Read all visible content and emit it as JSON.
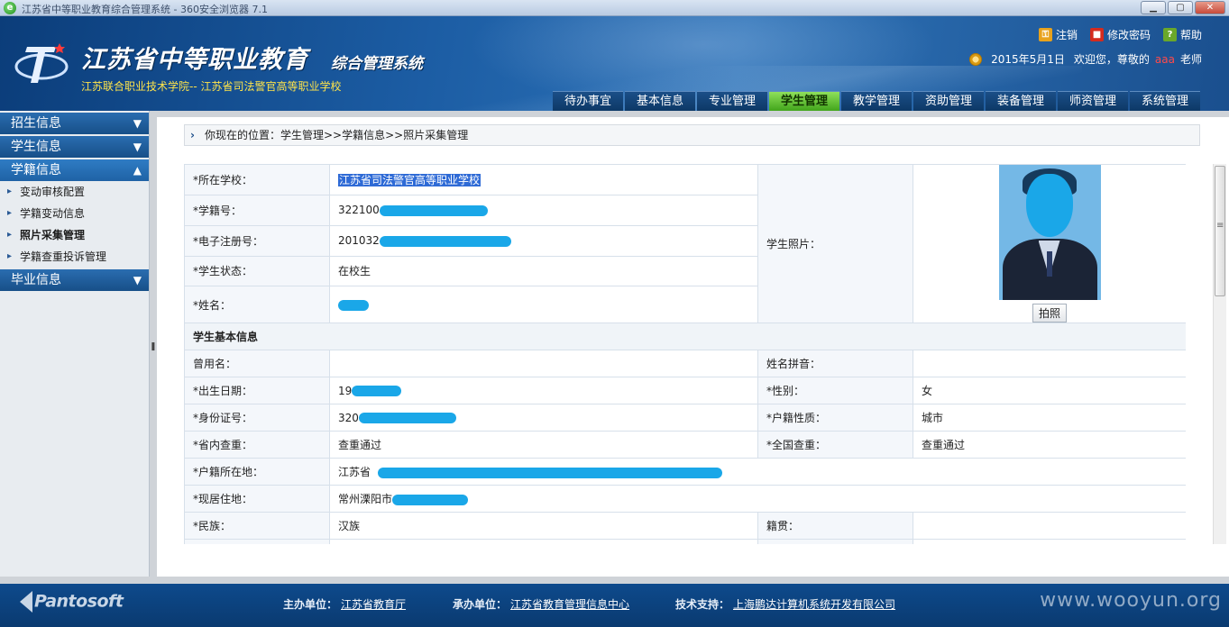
{
  "browser": {
    "title": "江苏省中等职业教育综合管理系统 - 360安全浏览器 7.1",
    "minimize": "▁",
    "maximize": "▢",
    "close": "✕"
  },
  "header": {
    "title": "江苏省中等职业教育",
    "subtitle": "综合管理系统",
    "school_line": "江苏联合职业技术学院-- 江苏省司法警官高等职业学校",
    "links": {
      "logout": "注销",
      "change_password": "修改密码",
      "help": "帮助"
    },
    "date": "2015年5月1日",
    "greeting": "欢迎您，尊敬的",
    "username": "aaa",
    "role": "老师"
  },
  "nav": {
    "tabs": [
      "待办事宜",
      "基本信息",
      "专业管理",
      "学生管理",
      "教学管理",
      "资助管理",
      "装备管理",
      "师资管理",
      "系统管理"
    ],
    "active": "学生管理"
  },
  "sidebar": {
    "sections": [
      {
        "label": "招生信息",
        "arrow": "▼"
      },
      {
        "label": "学生信息",
        "arrow": "▼"
      },
      {
        "label": "学籍信息",
        "arrow": "▲"
      },
      {
        "label": "毕业信息",
        "arrow": "▼"
      }
    ],
    "items": [
      "变动审核配置",
      "学籍变动信息",
      "照片采集管理",
      "学籍查重投诉管理"
    ],
    "current": "照片采集管理"
  },
  "breadcrumb": "你现在的位置：学生管理>>学籍信息>>照片采集管理",
  "record": {
    "school_label": "*所在学校：",
    "school_value": "江苏省司法警官高等职业学校",
    "student_no_label": "*学籍号：",
    "student_no_value": "322100",
    "ereg_label": "*电子注册号：",
    "ereg_value": "201032",
    "status_label": "*学生状态：",
    "status_value": "在校生",
    "name_label": "*姓名：",
    "photo_label": "学生照片：",
    "photo_button": "拍照",
    "section_basic": "学生基本信息",
    "former_name_label": "曾用名：",
    "pinyin_label": "姓名拼音：",
    "birth_label": "*出生日期：",
    "birth_value": "19",
    "gender_label": "*性别：",
    "gender_value": "女",
    "id_label": "*身份证号：",
    "id_value": "320",
    "hukou_type_label": "*户籍性质：",
    "hukou_type_value": "城市",
    "prov_check_label": "*省内查重：",
    "prov_check_value": "查重通过",
    "nat_check_label": "*全国查重：",
    "nat_check_value": "查重通过",
    "hukou_place_label": "*户籍所在地：",
    "hukou_place_value": "江苏省",
    "residence_label": "*现居住地：",
    "residence_value": "常州溧阳市",
    "ethnic_label": "*民族：",
    "ethnic_value": "汉族",
    "native_label": "籍贯："
  },
  "footer": {
    "brand": "Pantosoft",
    "host_label": "主办单位：",
    "host_value": "江苏省教育厅",
    "undertake_label": "承办单位：",
    "undertake_value": "江苏省教育管理信息中心",
    "tech_label": "技术支持：",
    "tech_value": "上海鹏达计算机系统开发有限公司",
    "watermark": "www.wooyun.org"
  }
}
